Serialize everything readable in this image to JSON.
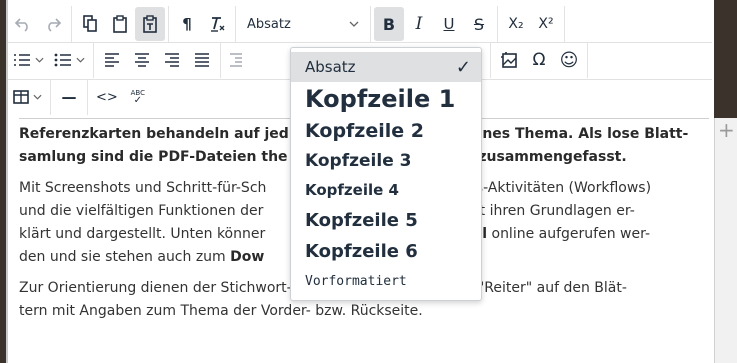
{
  "toolbar": {
    "format_select": {
      "value": "Absatz",
      "icon": "chevron-down-icon"
    },
    "row1": [
      {
        "name": "undo-button",
        "icon": "undo-icon"
      },
      {
        "name": "redo-button",
        "icon": "redo-icon"
      },
      {
        "name": "copy-button",
        "icon": "copy-icon"
      },
      {
        "name": "paste-button",
        "icon": "paste-icon"
      },
      {
        "name": "paste-text-button",
        "icon": "paste-text-icon"
      },
      {
        "name": "show-blocks-button",
        "icon": "pilcrow-icon"
      },
      {
        "name": "clear-format-button",
        "icon": "clear-format-icon"
      }
    ],
    "bold_label": "B",
    "italic_label": "I",
    "underline_label": "U",
    "strike_label": "S",
    "subscript_label": "X₂",
    "superscript_label": "X²",
    "pilcrow": "¶",
    "omega": "Ω",
    "smiley": "☺",
    "code": "<>",
    "spellcheck": "ABC",
    "dash": "—"
  },
  "dropdown": {
    "items": [
      {
        "label": "Absatz",
        "selected": true
      },
      {
        "label": "Kopfzeile 1"
      },
      {
        "label": "Kopfzeile 2"
      },
      {
        "label": "Kopfzeile 3"
      },
      {
        "label": "Kopfzeile 4"
      },
      {
        "label": "Kopfzeile 5"
      },
      {
        "label": "Kopfzeile 6"
      },
      {
        "label": "Vorformatiert"
      }
    ],
    "check": "✓"
  },
  "content": {
    "p1_l1a": "Referenzkarten behandeln auf jed",
    "p1_l1b": "enes Thema. Als lose Blatt-",
    "p1_l2a": "samlung sind die PDF-Dateien the",
    "p1_l2b": "n zusammengefasst.",
    "p2_l1a": "Mit Screenshots und Schritt-für-Sch",
    "p2_l1b": "Basis-Aktivitäten (Workflows)",
    "p2_l2a": "und die vielfältigen Funktionen der",
    "p2_l2b": "s mit ihren Grundlagen er-",
    "p2_l3a": "klärt und dargestellt. Unten könner",
    "p2_l3b_bold": "pitel",
    "p2_l3c": " online aufgerufen wer-",
    "p2_l4a": "den und sie stehen auch zum ",
    "p2_l4b_bold": "Dow",
    "p3_l1": "Zur Orientierung dienen der Stichwort-Index (online) und farbige \"Reiter\" auf den Blät-",
    "p3_l2": "tern mit Angaben zum Thema der Vorder- bzw. Rückseite."
  },
  "gutter": {
    "plus": "+"
  }
}
